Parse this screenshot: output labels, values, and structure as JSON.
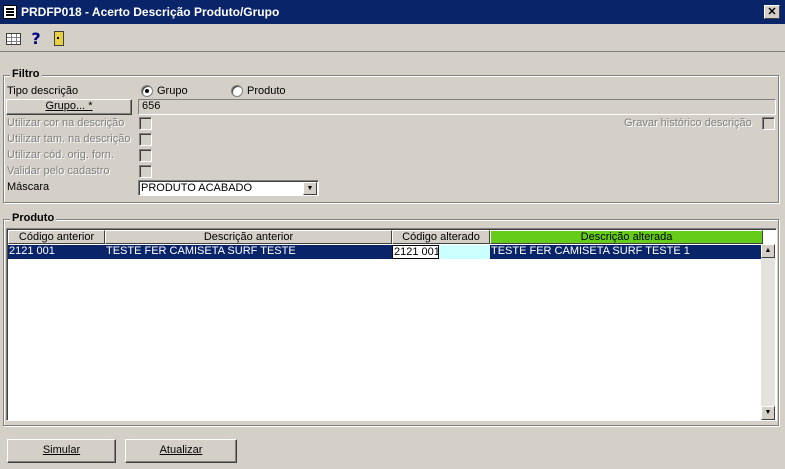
{
  "window": {
    "title": "PRDFP018 - Acerto Descrição Produto/Grupo",
    "close_label": "✕"
  },
  "toolbar": {
    "help_label": "?"
  },
  "filtro": {
    "label": "Filtro",
    "tipo_descricao_label": "Tipo descrição",
    "radio_grupo_label": "Grupo",
    "radio_produto_label": "Produto",
    "selected_option": "Grupo",
    "grupo_button_label": "Grupo... *",
    "grupo_value": "656",
    "utilizar_cor_label": "Utilizar cor na descrição",
    "utilizar_tam_label": "Utilizar tam. na descrição",
    "utilizar_cod_label": "Utilizar cód. orig. forn.",
    "validar_label": "Validar pelo cadastro",
    "gravar_historico_label": "Gravar histórico descrição",
    "mascara_label": "Máscara",
    "mascara_value": "PRODUTO ACABADO"
  },
  "produto": {
    "label": "Produto",
    "columns": [
      "Código anterior",
      "Descrição anterior",
      "Código alterado",
      "Descrição alterada"
    ],
    "rows": [
      {
        "codigo_anterior": "2121 001",
        "descricao_anterior": "TESTE FER CAMISETA SURF TESTE",
        "codigo_alterado": "2121 001",
        "descricao_alterada": "TESTE FER CAMISETA SURF TESTE 1"
      }
    ]
  },
  "actions": {
    "simular_label": "Simular",
    "atualizar_label": "Atualizar"
  },
  "colors": {
    "title_bar": "#0a246a",
    "selection": "#0a246a",
    "accent_header": "#66cc1a",
    "edit_cell": "#ccffff"
  }
}
